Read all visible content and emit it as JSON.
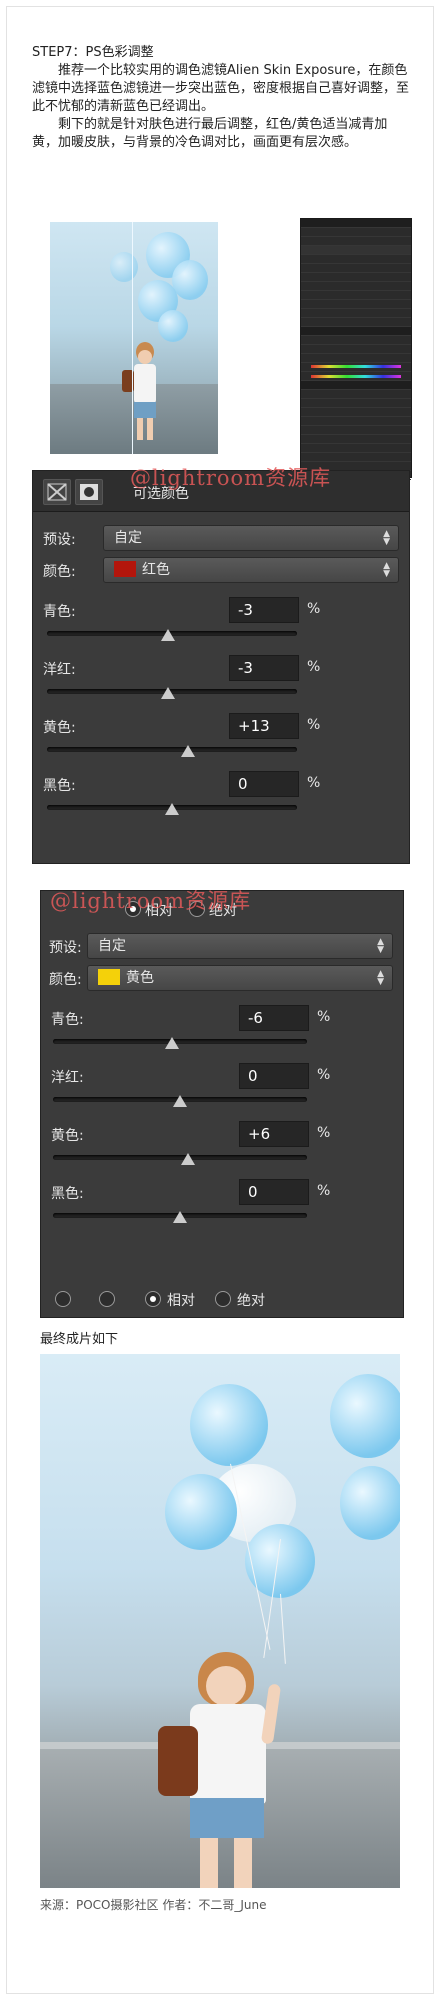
{
  "article": {
    "step_title": "STEP7：PS色彩调整",
    "para1": "推荐一个比较实用的调色滤镜Alien Skin Exposure，在颜色滤镜中选择蓝色滤镜进一步突出蓝色，密度根据自己喜好调整，至此不忧郁的清新蓝色已经调出。",
    "para2": "剩下的就是针对肤色进行最后调整，红色/黄色适当减青加黄，加暖皮肤，与背景的冷色调对比，画面更有层次感。"
  },
  "watermark": "@lightroom资源库",
  "panel_red": {
    "title": "可选颜色",
    "preset_label": "预设:",
    "preset_value": "自定",
    "color_label": "颜色:",
    "color_value": "红色",
    "swatch_color": "#b3160c",
    "sliders": [
      {
        "label": "青色:",
        "value": "-3",
        "unit": "%",
        "level": -3
      },
      {
        "label": "洋红:",
        "value": "-3",
        "unit": "%",
        "level": -3
      },
      {
        "label": "黄色:",
        "value": "+13",
        "unit": "%",
        "level": 13
      },
      {
        "label": "黑色:",
        "value": "0",
        "unit": "%",
        "level": 0
      }
    ]
  },
  "panel_yellow": {
    "radio_relative": "相对",
    "radio_absolute": "绝对",
    "preset_label": "预设:",
    "preset_value": "自定",
    "color_label": "颜色:",
    "color_value": "黄色",
    "swatch_color": "#f4d10a",
    "sliders": [
      {
        "label": "青色:",
        "value": "-6",
        "unit": "%",
        "level": -6
      },
      {
        "label": "洋红:",
        "value": "0",
        "unit": "%",
        "level": 0
      },
      {
        "label": "黄色:",
        "value": "+6",
        "unit": "%",
        "level": 6
      },
      {
        "label": "黑色:",
        "value": "0",
        "unit": "%",
        "level": 0
      }
    ],
    "bottom_relative": "相对",
    "bottom_absolute": "绝对"
  },
  "final_caption": "最终成片如下",
  "source_text": "来源：POCO摄影社区  作者：不二哥_June"
}
